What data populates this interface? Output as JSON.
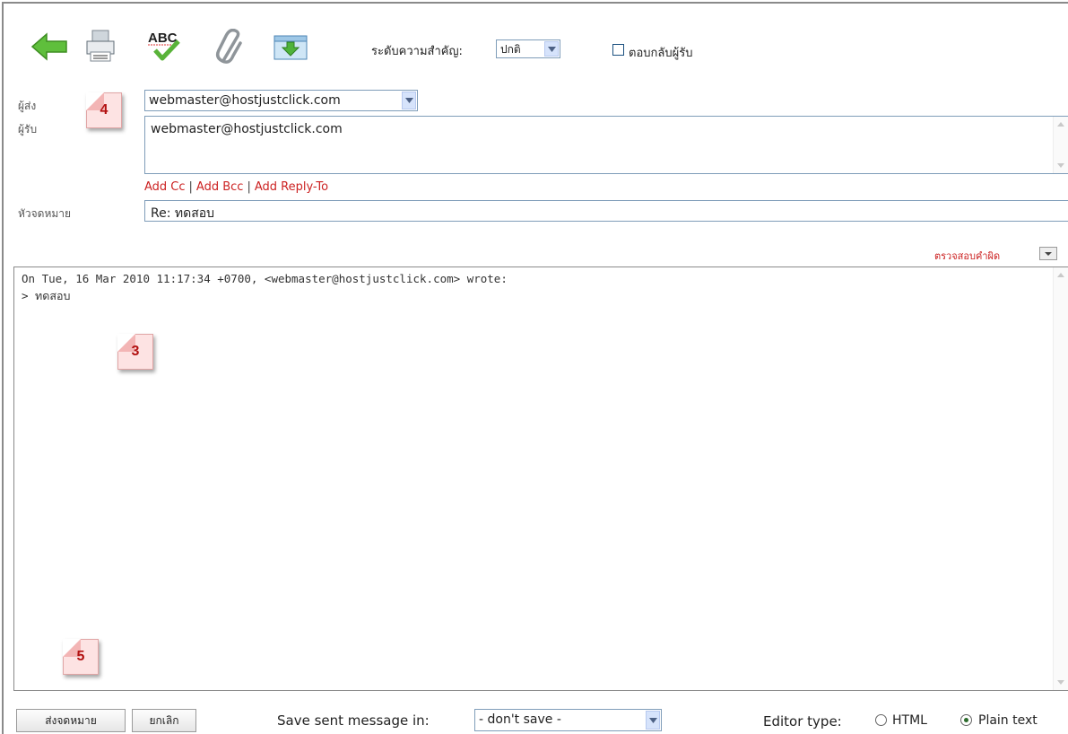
{
  "toolbar": {
    "icons": [
      "back-arrow-icon",
      "print-icon",
      "spellcheck-icon",
      "attach-icon",
      "save-draft-icon"
    ],
    "importance_label": "ระดับความสำคัญ:",
    "importance_value": "ปกติ",
    "return_receipt_label": "ตอบกลับผู้รับ",
    "return_receipt_checked": false
  },
  "form": {
    "from_label": "ผู้ส่ง",
    "from_value": "webmaster@hostjustclick.com",
    "to_label": "ผู้รับ",
    "to_value": "webmaster@hostjustclick.com",
    "add_cc": "Add Cc",
    "add_bcc": "Add Bcc",
    "add_reply_to": "Add Reply-To",
    "subject_label": "หัวจดหมาย",
    "subject_value": "Re: ทดสอบ",
    "spellcheck_label": "ตรวจสอบคำผิด"
  },
  "editor": {
    "body": "On Tue, 16 Mar 2010 11:17:34 +0700, <webmaster@hostjustclick.com> wrote:\n> ทดสอบ"
  },
  "callouts": [
    "4",
    "3",
    "5"
  ],
  "footer": {
    "send_button": "ส่งจดหมาย",
    "cancel_button": "ยกเลิก",
    "save_sent_label": "Save sent message in:",
    "save_sent_value": "- don't save -",
    "editor_type_label": "Editor type:",
    "editor_html": "HTML",
    "editor_plain": "Plain text",
    "editor_selected": "Plain text"
  },
  "colors": {
    "link_red": "#cc2222",
    "border_blue": "#7f9db9",
    "callout_fill": "#fde3e3",
    "callout_text": "#b21010"
  }
}
